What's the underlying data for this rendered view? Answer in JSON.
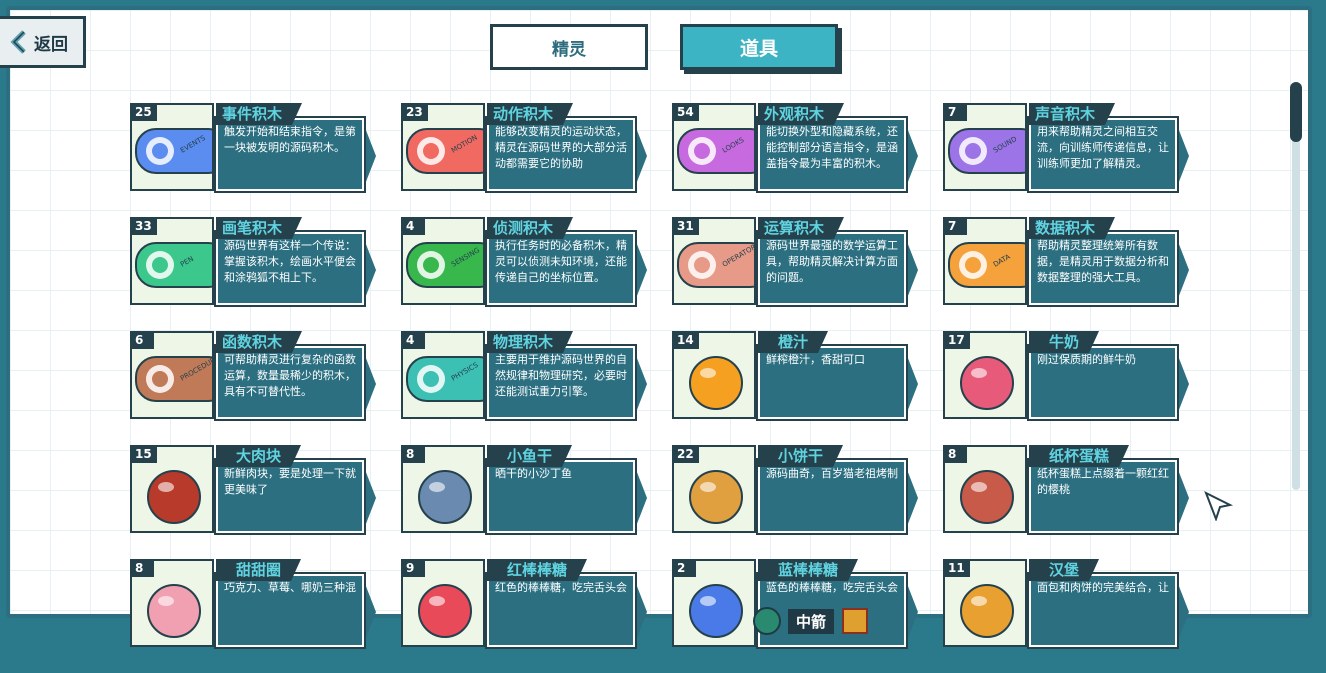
{
  "nav": {
    "back_label": "返回"
  },
  "tabs": [
    {
      "label": "精灵",
      "active": false
    },
    {
      "label": "道具",
      "active": true
    }
  ],
  "items": [
    {
      "count": "25",
      "title": "事件积木",
      "desc": "触发开始和结束指令，是第一块被发明的源码积木。",
      "icon": "events-block-icon",
      "color": "#5b8cf0",
      "tag": "EVENTS"
    },
    {
      "count": "23",
      "title": "动作积木",
      "desc": "能够改变精灵的运动状态，精灵在源码世界的大部分活动都需要它的协助",
      "icon": "motion-block-icon",
      "color": "#f06a62",
      "tag": "MOTION"
    },
    {
      "count": "54",
      "title": "外观积木",
      "desc": "能切换外型和隐藏系统，还能控制部分语言指令，是涵盖指令最为丰富的积木。",
      "icon": "looks-block-icon",
      "color": "#c86adf",
      "tag": "LOOKS"
    },
    {
      "count": "7",
      "title": "声音积木",
      "desc": "用来帮助精灵之间相互交流，向训练师传递信息，让训练师更加了解精灵。",
      "icon": "sound-block-icon",
      "color": "#9c74e8",
      "tag": "SOUND"
    },
    {
      "count": "33",
      "title": "画笔积木",
      "desc": "源码世界有这样一个传说：掌握该积木，绘画水平便会和涂鸦狐不相上下。",
      "icon": "pen-block-icon",
      "color": "#3cc88c",
      "tag": "PEN"
    },
    {
      "count": "4",
      "title": "侦测积木",
      "desc": "执行任务时的必备积木，精灵可以侦测未知环境，还能传递自己的坐标位置。",
      "icon": "sensing-block-icon",
      "color": "#38b84c",
      "tag": "SENSING"
    },
    {
      "count": "31",
      "title": "运算积木",
      "desc": "源码世界最强的数学运算工具，帮助精灵解决计算方面的问题。",
      "icon": "operators-block-icon",
      "color": "#e89a88",
      "tag": "OPERATORS"
    },
    {
      "count": "7",
      "title": "数据积木",
      "desc": "帮助精灵整理统筹所有数据，是精灵用于数据分析和数据整理的强大工具。",
      "icon": "data-block-icon",
      "color": "#f5a13c",
      "tag": "DATA"
    },
    {
      "count": "6",
      "title": "函数积木",
      "desc": "可帮助精灵进行复杂的函数运算，数量最稀少的积木，具有不可替代性。",
      "icon": "procedures-block-icon",
      "color": "#c07a58",
      "tag": "PROCEDURES"
    },
    {
      "count": "4",
      "title": "物理积木",
      "desc": "主要用于维护源码世界的自然规律和物理研究，必要时还能测试重力引擎。",
      "icon": "physics-block-icon",
      "color": "#3cc0b4",
      "tag": "PHYSICS"
    },
    {
      "count": "14",
      "title": "橙汁",
      "desc": "鲜榨橙汁，香甜可口",
      "icon": "orange-juice-icon",
      "color": "#f5a020",
      "tag": ""
    },
    {
      "count": "17",
      "title": "牛奶",
      "desc": "刚过保质期的鲜牛奶",
      "icon": "milk-carton-icon",
      "color": "#e85a7a",
      "tag": ""
    },
    {
      "count": "15",
      "title": "大肉块",
      "desc": "新鲜肉块，要是处理一下就更美味了",
      "icon": "meat-chunk-icon",
      "color": "#b83a2a",
      "tag": ""
    },
    {
      "count": "8",
      "title": "小鱼干",
      "desc": "晒干的小沙丁鱼",
      "icon": "dried-fish-icon",
      "color": "#6a8ab0",
      "tag": ""
    },
    {
      "count": "22",
      "title": "小饼干",
      "desc": "源码曲奇，百岁猫老祖烤制",
      "icon": "cookie-icon",
      "color": "#e0a040",
      "tag": ""
    },
    {
      "count": "8",
      "title": "纸杯蛋糕",
      "desc": "纸杯蛋糕上点缀着一颗红红的樱桃",
      "icon": "cupcake-icon",
      "color": "#c85a4a",
      "tag": ""
    },
    {
      "count": "8",
      "title": "甜甜圈",
      "desc": "巧克力、草莓、哪奶三种混",
      "icon": "donut-icon",
      "color": "#f0a0b0",
      "tag": ""
    },
    {
      "count": "9",
      "title": "红棒棒糖",
      "desc": "红色的棒棒糖，吃完舌头会",
      "icon": "red-lollipop-icon",
      "color": "#e84a5a",
      "tag": ""
    },
    {
      "count": "2",
      "title": "蓝棒棒糖",
      "desc": "蓝色的棒棒糖，吃完舌头会",
      "icon": "blue-lollipop-icon",
      "color": "#4a7ae8",
      "tag": ""
    },
    {
      "count": "11",
      "title": "汉堡",
      "desc": "面包和肉饼的完美结合，让",
      "icon": "hamburger-icon",
      "color": "#e8a030",
      "tag": ""
    }
  ],
  "footer": {
    "player_name": "中箭"
  }
}
